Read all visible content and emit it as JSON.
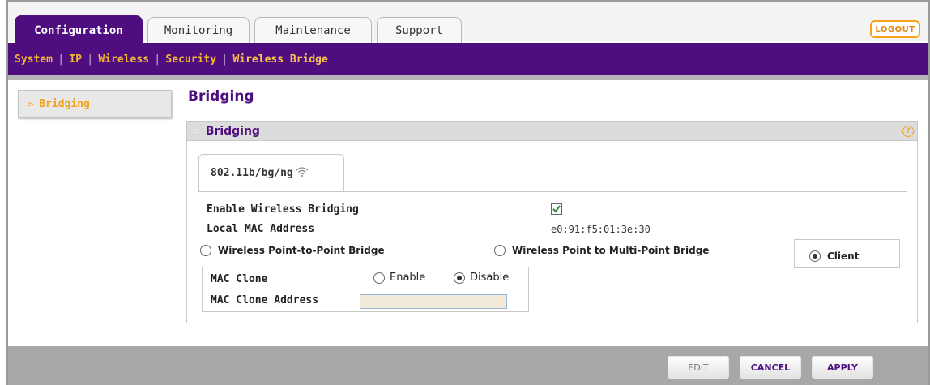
{
  "tabs": [
    {
      "label": "Configuration",
      "active": true
    },
    {
      "label": "Monitoring",
      "active": false
    },
    {
      "label": "Maintenance",
      "active": false
    },
    {
      "label": "Support",
      "active": false
    }
  ],
  "logout_label": "LOGOUT",
  "subnav": {
    "items": [
      "System",
      "IP",
      "Wireless",
      "Security",
      "Wireless Bridge"
    ],
    "current": "Wireless Bridge"
  },
  "leftnav": {
    "item": "Bridging"
  },
  "page_title": "Bridging",
  "panel": {
    "title": "Bridging",
    "help_icon": "question-circle-icon",
    "radio_tab": "802.11b/bg/ng",
    "enable_label": "Enable Wireless Bridging",
    "enable_checked": true,
    "mac_label": "Local MAC Address",
    "mac_value": "e0:91:f5:01:3e:30",
    "modes": [
      {
        "label": "Wireless Point-to-Point Bridge",
        "selected": false
      },
      {
        "label": "Wireless Point to Multi-Point Bridge",
        "selected": false
      },
      {
        "label": "Client",
        "selected": true
      }
    ],
    "mac_clone_label": "MAC Clone",
    "mac_clone_options": [
      {
        "label": "Enable",
        "selected": false
      },
      {
        "label": "Disable",
        "selected": true
      }
    ],
    "mac_clone_address_label": "MAC Clone Address",
    "mac_clone_address_value": ""
  },
  "buttons": {
    "edit": "EDIT",
    "cancel": "CANCEL",
    "apply": "APPLY"
  },
  "colors": {
    "brand_purple": "#4e0e80",
    "accent_orange": "#f6a21a"
  }
}
